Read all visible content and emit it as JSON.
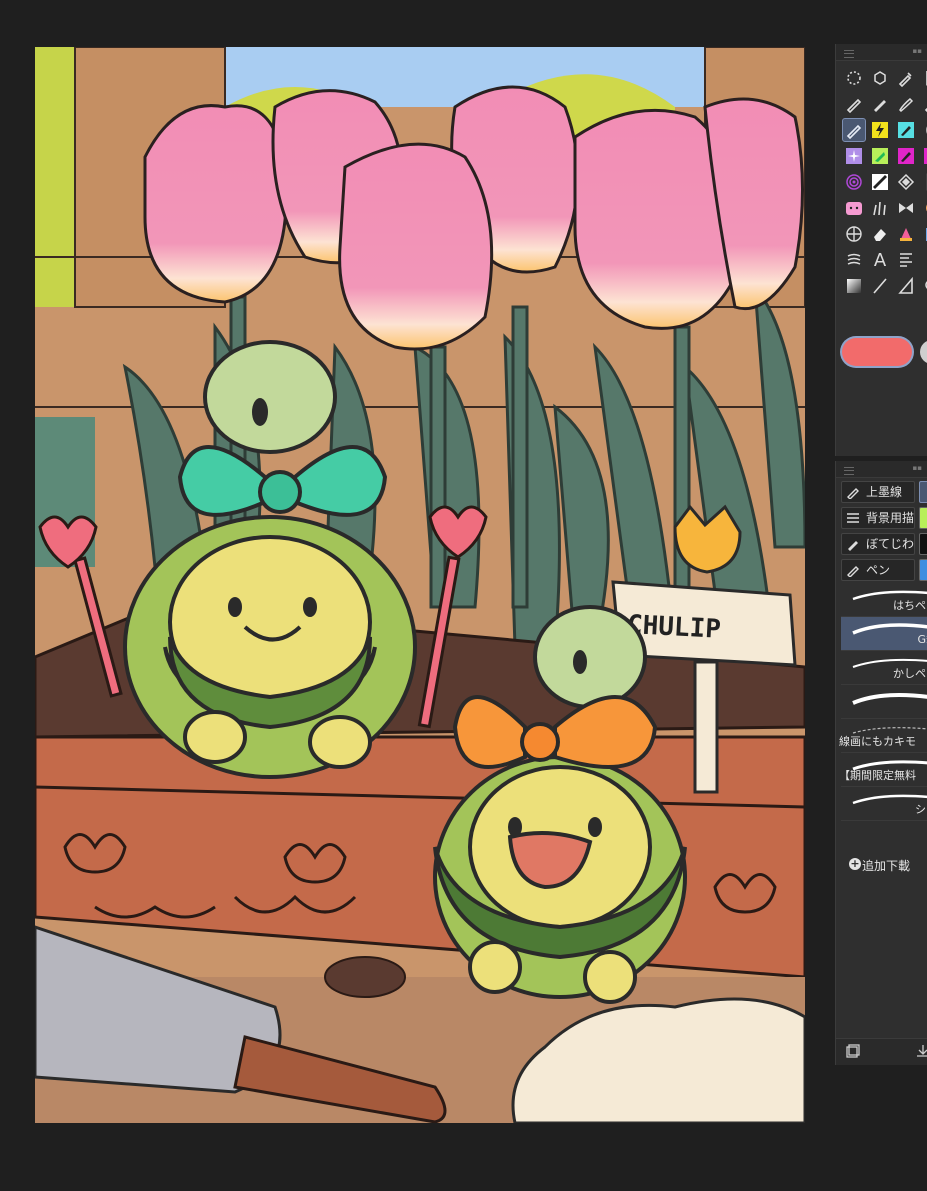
{
  "canvas": {
    "sign_text": "CHULIP"
  },
  "tool_palette": {
    "tools": [
      {
        "name": "lasso-select-icon"
      },
      {
        "name": "move-object-icon"
      },
      {
        "name": "eyedropper-icon"
      },
      {
        "name": "cursor-icon"
      },
      {
        "name": "pen-icon"
      },
      {
        "name": "pencil-icon"
      },
      {
        "name": "brush-icon"
      },
      {
        "name": "pen-alt-icon"
      },
      {
        "name": "pen-tool-active-icon"
      },
      {
        "name": "lightning-brush-icon"
      },
      {
        "name": "ink-pen-icon"
      },
      {
        "name": "ellipse-icon"
      },
      {
        "name": "sparkle-brush-icon"
      },
      {
        "name": "leaf-brush-icon"
      },
      {
        "name": "magenta-brush-icon"
      },
      {
        "name": "letter-brush-icon"
      },
      {
        "name": "spiral-icon"
      },
      {
        "name": "pattern-brush-icon"
      },
      {
        "name": "checker-icon"
      },
      {
        "name": "notebook-icon"
      },
      {
        "name": "cat-face-icon"
      },
      {
        "name": "grass-brush-icon"
      },
      {
        "name": "ribbon-icon"
      },
      {
        "name": "orange-icon"
      },
      {
        "name": "grid-ruler-icon"
      },
      {
        "name": "eraser-icon"
      },
      {
        "name": "cake-icon"
      },
      {
        "name": "blue-square-icon"
      },
      {
        "name": "blend-icon"
      },
      {
        "name": "text-icon"
      },
      {
        "name": "frame-icon"
      },
      {
        "name": "blank-icon"
      },
      {
        "name": "gradient-icon"
      },
      {
        "name": "line-icon"
      },
      {
        "name": "figure-icon"
      },
      {
        "name": "balloon-icon"
      }
    ],
    "main_color": "#f26b6b",
    "sub_color": "#cfcfcf"
  },
  "sub_tool_panel": {
    "tabs": [
      {
        "label": "上墨線"
      },
      {
        "label": "背景用描"
      },
      {
        "label": "ぼてじわ"
      },
      {
        "label": "ペン"
      }
    ],
    "brushes": [
      {
        "label": "はちペン"
      },
      {
        "label": "G筆"
      },
      {
        "label": "かしペン"
      },
      {
        "label": ""
      },
      {
        "label": "線画にもカキモ"
      },
      {
        "label": "【期間限定無料"
      },
      {
        "label": "シミ"
      }
    ],
    "add_download": "追加下載"
  }
}
